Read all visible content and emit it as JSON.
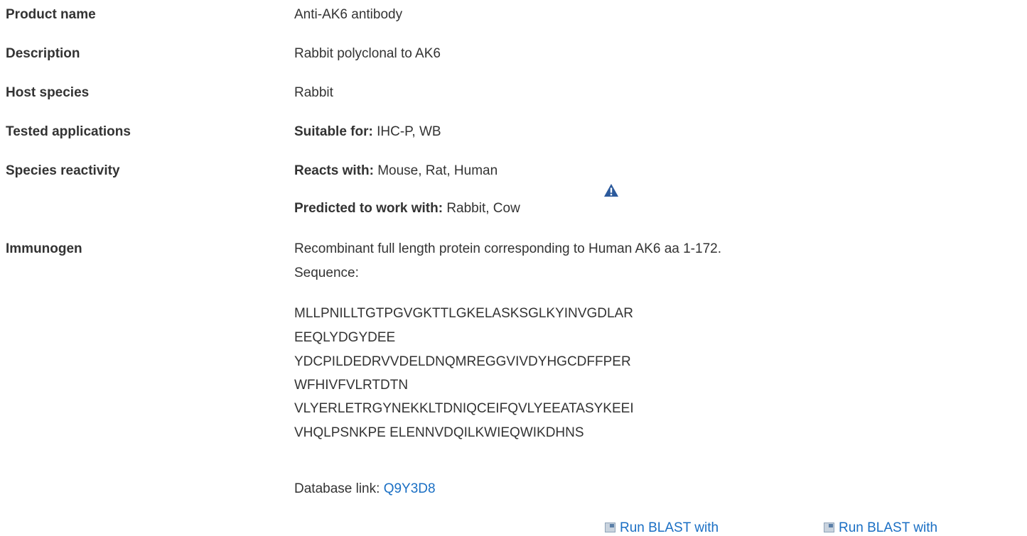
{
  "rows": {
    "product_name": {
      "label": "Product name",
      "value": "Anti-AK6 antibody"
    },
    "description": {
      "label": "Description",
      "value": "Rabbit polyclonal to AK6"
    },
    "host_species": {
      "label": "Host species",
      "value": "Rabbit"
    },
    "tested_applications": {
      "label": "Tested applications",
      "prefix": "Suitable for:",
      "value": "IHC-P, WB"
    },
    "species_reactivity": {
      "label": "Species reactivity",
      "reacts_prefix": "Reacts with:",
      "reacts_value": "Mouse, Rat, Human",
      "predicted_prefix": "Predicted to work with:",
      "predicted_value": "Rabbit, Cow",
      "warning_icon": "warning-triangle-icon"
    },
    "immunogen": {
      "label": "Immunogen",
      "value": "Recombinant full length protein corresponding to Human AK6 aa 1-172.",
      "sequence_label": "Sequence:",
      "sequence_lines": [
        "MLLPNILLTGTPGVGKTTLGKELASKSGLKYINVGDLAR",
        "EEQLYDGYDEE",
        "YDCPILDEDRVVDELDNQMREGGVIVDYHGCDFFPER",
        "WFHIVFVLRTDTN",
        "VLYERLETRGYNEKKLTDNIQCEIFQVLYEEATASYKEEI",
        "VHQLPSNKPE ELENNVDQILKWIEQWIKDHNS"
      ],
      "database_link_prefix": "Database link:",
      "database_link": "Q9Y3D8"
    }
  },
  "blast_links": [
    "Run BLAST with",
    "Run BLAST with"
  ],
  "colors": {
    "text": "#333333",
    "link": "#1a6fc4",
    "warning": "#2c5a9c"
  }
}
